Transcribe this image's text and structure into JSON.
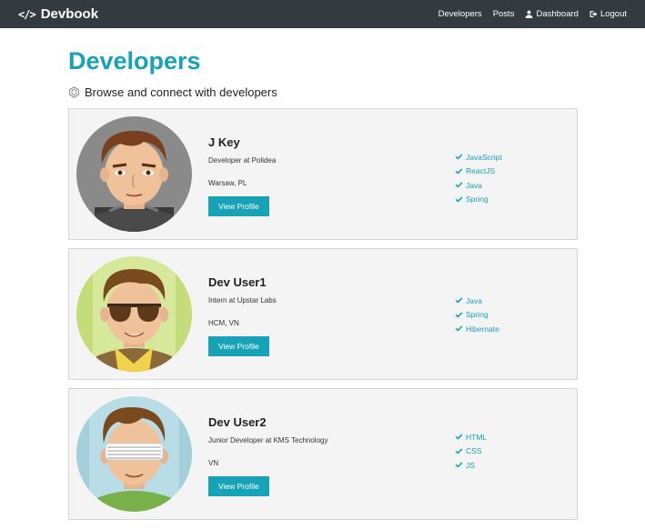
{
  "navbar": {
    "brand_icon": "</>",
    "brand": "Devbook",
    "links": [
      {
        "label": "Developers"
      },
      {
        "label": "Posts"
      },
      {
        "label": "Dashboard",
        "icon": "user-icon"
      },
      {
        "label": "Logout",
        "icon": "sign-out-icon"
      }
    ]
  },
  "page": {
    "title": "Developers",
    "lead": "Browse and connect with developers",
    "lead_icon": "connect-icon"
  },
  "profiles": [
    {
      "name": "J Key",
      "status": "Developer at Polidea",
      "location": "Warsaw, PL",
      "button": "View Profile",
      "avatar_bg": "#8a8a8a",
      "skills": [
        "JavaScript",
        "ReactJS",
        "Java",
        "Spring"
      ]
    },
    {
      "name": "Dev User1",
      "status": "Intern at Upstar Labs",
      "location": "HCM, VN",
      "button": "View Profile",
      "avatar_bg": "#d6e89a",
      "skills": [
        "Java",
        "Spring",
        "Hibernate"
      ]
    },
    {
      "name": "Dev User2",
      "status": "Junior Developer at KMS Technology",
      "location": "VN",
      "button": "View Profile",
      "avatar_bg": "#b8dde6",
      "skills": [
        "HTML",
        "CSS",
        "JS"
      ]
    }
  ],
  "colors": {
    "navbar_bg": "#343a40",
    "accent": "#17a2b8",
    "card_bg": "#f4f4f4"
  }
}
